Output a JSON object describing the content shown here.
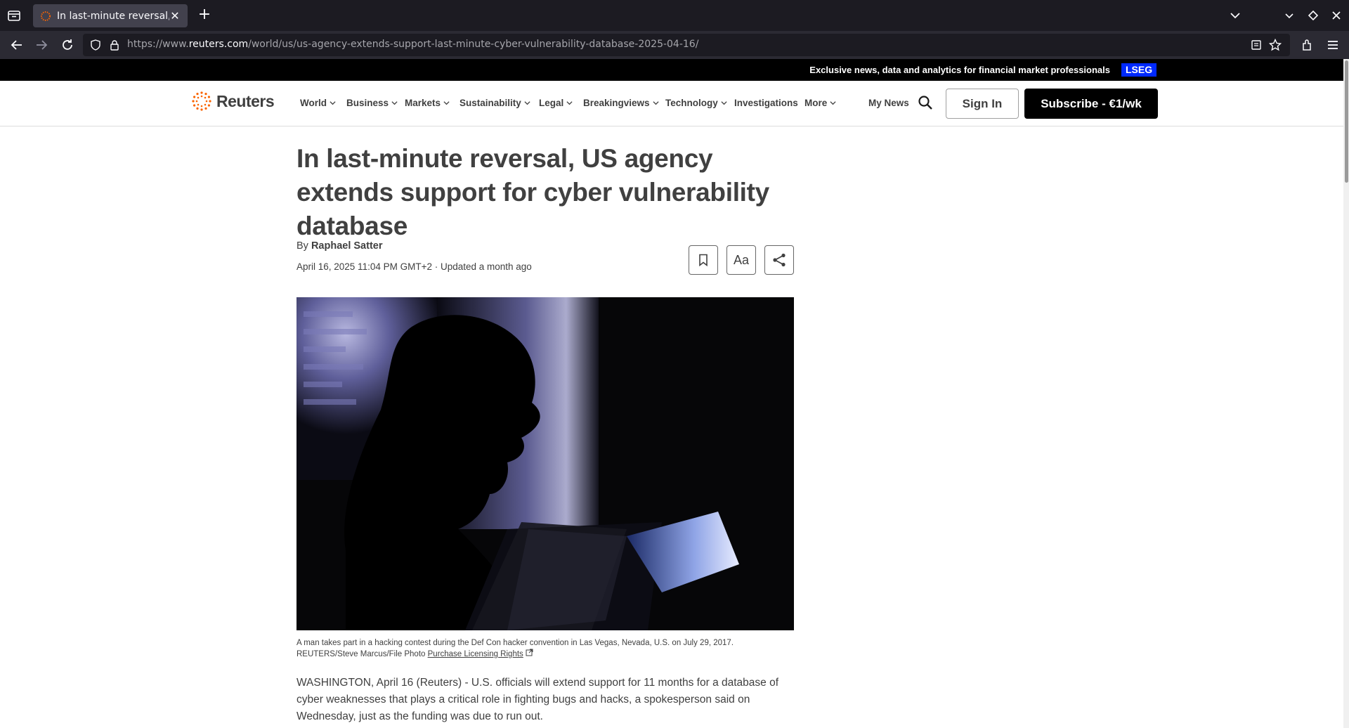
{
  "browser": {
    "tab_title": "In last-minute reversal, US",
    "url_prefix": "https://www.",
    "url_host": "reuters.com",
    "url_path": "/world/us/us-agency-extends-support-last-minute-cyber-vulnerability-database-2025-04-16/"
  },
  "banner": {
    "text": "Exclusive news, data and analytics for financial market professionals",
    "badge": "LSEG"
  },
  "header": {
    "logo_text": "Reuters",
    "nav": [
      {
        "label": "World",
        "dropdown": true
      },
      {
        "label": "Business",
        "dropdown": true
      },
      {
        "label": "Markets",
        "dropdown": true
      },
      {
        "label": "Sustainability",
        "dropdown": true
      },
      {
        "label": "Legal",
        "dropdown": true
      },
      {
        "label": "Breakingviews",
        "dropdown": true
      },
      {
        "label": "Technology",
        "dropdown": true
      },
      {
        "label": "Investigations",
        "dropdown": false
      },
      {
        "label": "More",
        "dropdown": true
      }
    ],
    "my_news": "My News",
    "sign_in": "Sign In",
    "subscribe": "Subscribe - €1/wk"
  },
  "article": {
    "headline": "In last-minute reversal, US agency extends support for cyber vulnerability database",
    "by": "By",
    "author": "Raphael Satter",
    "dateline": "April 16, 2025 11:04 PM GMT+2 · Updated a month ago",
    "aa_label": "Aa",
    "caption": "A man takes part in a hacking contest during the Def Con hacker convention in Las Vegas, Nevada, U.S. on July 29, 2017. REUTERS/Steve Marcus/File Photo",
    "licensing": "Purchase Licensing Rights",
    "body": "WASHINGTON, April 16 (Reuters) - U.S. officials will extend support for 11 months for a database of cyber weaknesses that plays a critical role in fighting bugs and hacks, a spokesperson said on Wednesday, just as the funding was due to run out."
  },
  "colors": {
    "brand_orange": "#fa6400",
    "lseg_blue": "#0029ff",
    "text": "#404040"
  }
}
